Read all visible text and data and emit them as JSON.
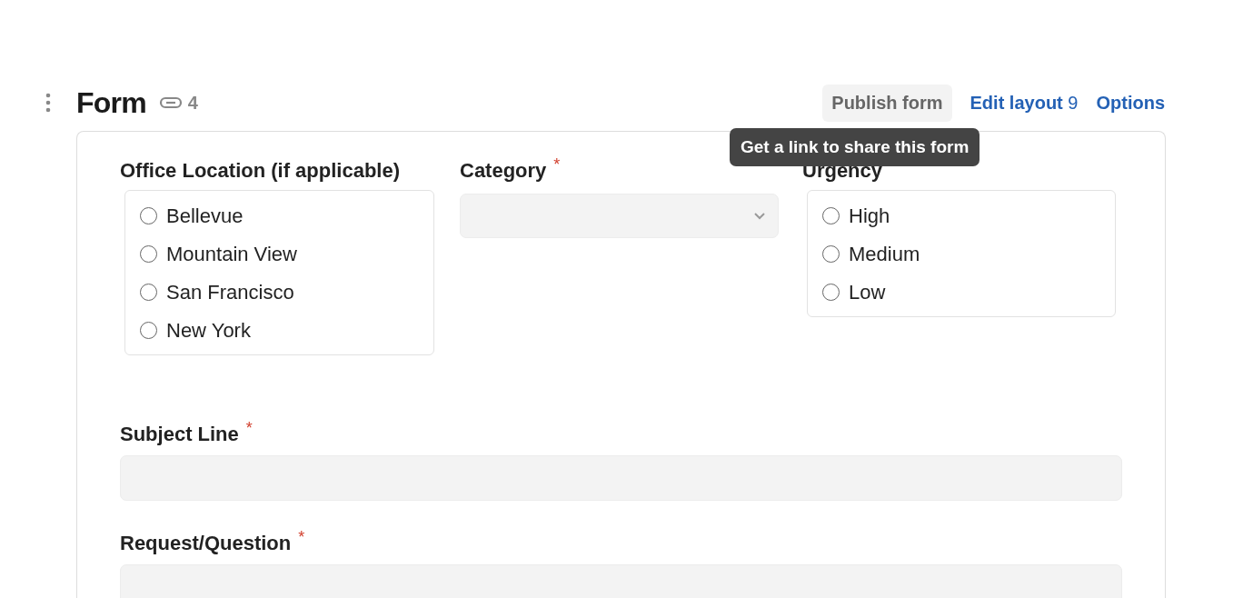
{
  "header": {
    "title": "Form",
    "link_count": "4",
    "actions": [
      {
        "kind": "publish",
        "label": "Publish form"
      },
      {
        "kind": "link",
        "label": "Edit layout",
        "count": "9"
      },
      {
        "kind": "link",
        "label": "Options"
      }
    ],
    "tooltip": "Get a link to share this form"
  },
  "fields": [
    {
      "kind": "radio",
      "label": "Office Location (if applicable)",
      "options": [
        {
          "label": "Bellevue",
          "selected": false
        },
        {
          "label": "Mountain View",
          "selected": false
        },
        {
          "label": "San Francisco",
          "selected": false
        },
        {
          "label": "New York",
          "selected": false
        }
      ]
    },
    {
      "kind": "select",
      "label": "Category",
      "required_mark": "*"
    },
    {
      "kind": "radio",
      "label": "Urgency",
      "options": [
        {
          "label": "High",
          "selected": false
        },
        {
          "label": "Medium",
          "selected": false
        },
        {
          "label": "Low",
          "selected": false
        }
      ]
    },
    {
      "kind": "text",
      "label": "Subject Line",
      "required_mark": "*"
    },
    {
      "kind": "text",
      "label": "Request/Question",
      "required_mark": "*"
    }
  ]
}
